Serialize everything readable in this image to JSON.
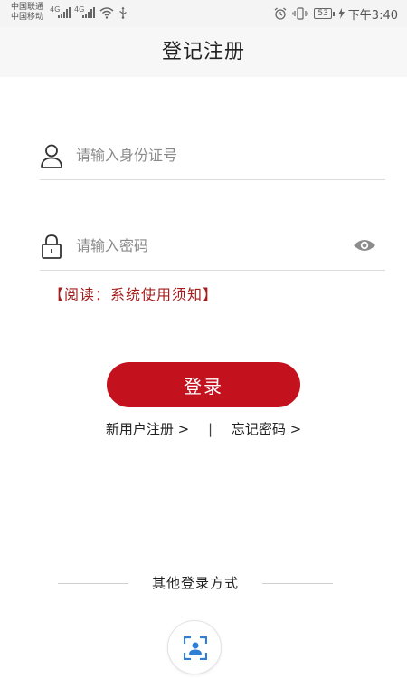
{
  "status_bar": {
    "carrier1": "中国联通",
    "carrier2": "中国移动",
    "network1": "4G",
    "network2": "4G",
    "battery": "53",
    "time": "下午3:40"
  },
  "header": {
    "title": "登记注册"
  },
  "login_form": {
    "id_placeholder": "请输入身份证号",
    "id_value": "",
    "password_placeholder": "请输入密码",
    "password_value": "",
    "notice": "【阅读：系统使用须知】",
    "login_label": "登录"
  },
  "links": {
    "register": "新用户注册 >",
    "separator": "|",
    "forgot": "忘记密码 >"
  },
  "other_login": {
    "label": "其他登录方式"
  },
  "icons": {
    "user": "user-icon",
    "lock": "lock-icon",
    "eye": "eye-icon",
    "face": "face-scan-icon",
    "alarm": "alarm-icon",
    "vibrate": "vibrate-icon",
    "wifi": "wifi-icon",
    "usb": "usb-icon"
  },
  "colors": {
    "accent": "#c3111e",
    "notice": "#a51c1c",
    "face_icon": "#2f7fd6"
  }
}
